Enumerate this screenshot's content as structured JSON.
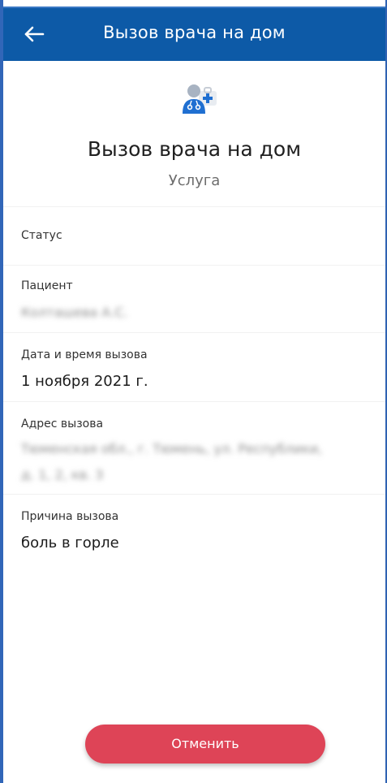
{
  "colors": {
    "appbar": "#0d5aa7",
    "accent_button": "#de4457",
    "icon_blue": "#1f6fd1"
  },
  "appbar": {
    "back_icon": "arrow-left-icon",
    "title": "Вызов врача на дом"
  },
  "hero": {
    "icon": "doctor-medkit-icon",
    "title": "Вызов врача на дом",
    "subtitle": "Услуга"
  },
  "fields": {
    "status": {
      "label": "Статус",
      "value": ""
    },
    "patient": {
      "label": "Пациент",
      "value": "Колташева А.С."
    },
    "datetime": {
      "label": "Дата и время вызова",
      "value": "1 ноября 2021 г."
    },
    "address": {
      "label": "Адрес вызова",
      "value_line1": "Тюменская обл., г. Тюмень, ул. Республики,",
      "value_line2": "д. 1, 2, кв. 3"
    },
    "reason": {
      "label": "Причина вызова",
      "value": "боль в горле"
    }
  },
  "actions": {
    "cancel_label": "Отменить"
  }
}
